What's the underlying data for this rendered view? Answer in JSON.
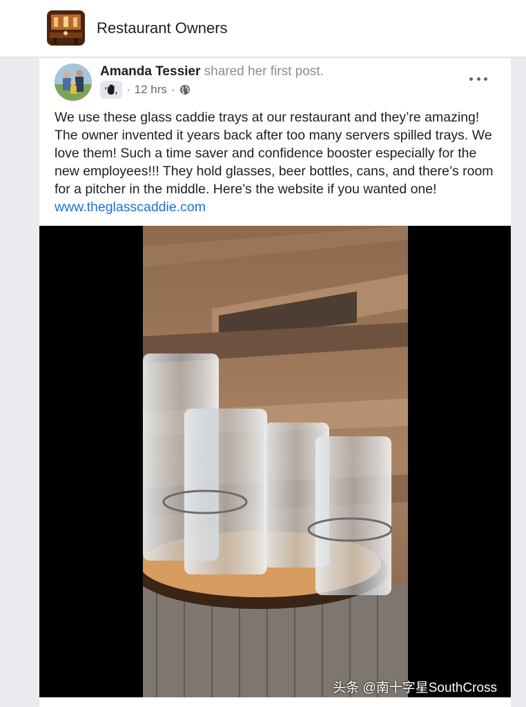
{
  "group": {
    "name": "Restaurant Owners"
  },
  "post": {
    "author": "Amanda Tessier",
    "action_text": "shared her first post.",
    "time": "12 hrs",
    "separator": "·",
    "text": "We use these glass caddie trays at our restaurant and they’re amazing! The owner invented it years back after too many servers spilled trays. We love them! Such a time saver and confidence booster especially for the new employees!!! They hold glasses, beer bottles, cans, and there’s room for a pitcher in the middle. Here’s the website if you wanted one!",
    "link": "www.theglasscaddie.com",
    "more_icon": "more-horizontal-icon",
    "badge_icon": "waving-hand-icon",
    "privacy_icon": "globe-icon"
  },
  "video": {
    "watermark": "头条 @南十字星SouthCross",
    "controls": [
      "fullscreen-icon",
      "picture-in-picture-icon",
      "muted-icon"
    ]
  },
  "colors": {
    "link": "#216fdb",
    "background": "#e9ebee"
  }
}
